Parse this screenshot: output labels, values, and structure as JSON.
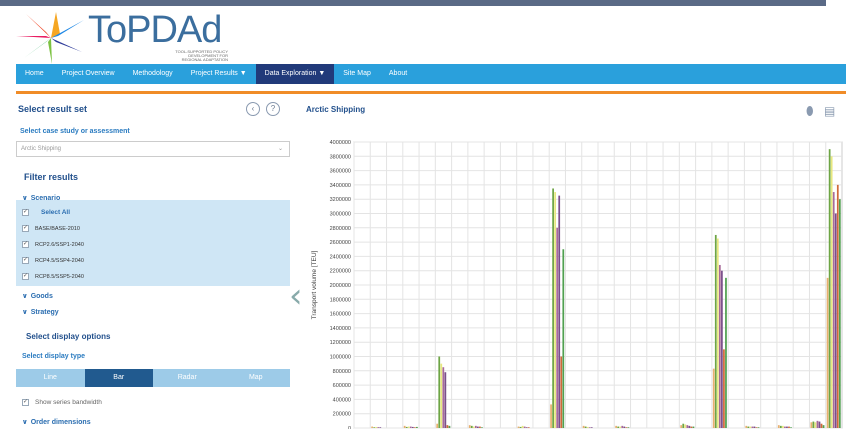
{
  "header": {
    "logo_text": "ToPDAd",
    "logo_sub": "TOOL-SUPPORTED POLICY DEVELOPMENT FOR REGIONAL ADAPTATION"
  },
  "nav": {
    "items": [
      {
        "label": "Home",
        "active": false
      },
      {
        "label": "Project Overview",
        "active": false
      },
      {
        "label": "Methodology",
        "active": false
      },
      {
        "label": "Project Results ▼",
        "active": false
      },
      {
        "label": "Data Exploration ▼",
        "active": true
      },
      {
        "label": "Site Map",
        "active": false
      },
      {
        "label": "About",
        "active": false
      }
    ]
  },
  "left": {
    "select_result_set": "Select result set",
    "back_icon": "‹",
    "help_icon": "?",
    "case_study_label": "Select case study or assessment",
    "case_study_value": "Arctic Shipping",
    "filter_results": "Filter results",
    "scenario": "Scenario",
    "select_all": "Select All",
    "scenarios": [
      "BASE/BASE-2010",
      "RCP2.6/SSP1-2040",
      "RCP4.5/SSP4-2040",
      "RCP8.5/SSP5-2040"
    ],
    "goods": "Goods",
    "strategy": "Strategy",
    "display_options": "Select display options",
    "display_type_label": "Select display type",
    "display_types": [
      {
        "label": "Line",
        "active": false
      },
      {
        "label": "Bar",
        "active": true
      },
      {
        "label": "Radar",
        "active": false
      },
      {
        "label": "Map",
        "active": false
      }
    ],
    "show_bandwidth": "Show series bandwidth",
    "order_dimensions": "Order dimensions"
  },
  "chart_title": "Arctic Shipping",
  "chart_data": {
    "type": "bar",
    "ylabel": "Transport volume [TEU]",
    "ylim": [
      0,
      4000000
    ],
    "ytick_labels": [
      "0",
      "200000",
      "400000",
      "600000",
      "800000",
      "1000000",
      "1200000",
      "1400000",
      "1600000",
      "1800000",
      "2000000",
      "2200000",
      "2400000",
      "2600000",
      "2800000",
      "3000000",
      "3200000",
      "3400000",
      "3600000",
      "3800000",
      "4000000"
    ],
    "series_colors": [
      "#e8b070",
      "#6da545",
      "#e8e880",
      "#a86a9a",
      "#7a4f8a",
      "#d06a3a",
      "#50a050"
    ],
    "groups": [
      {
        "values": [
          0,
          0,
          0,
          0,
          0,
          0,
          0
        ]
      },
      {
        "values": [
          20000,
          10000,
          15000,
          12000,
          10000,
          0,
          0
        ]
      },
      {
        "values": [
          0,
          0,
          0,
          0,
          0,
          0,
          0
        ]
      },
      {
        "values": [
          30000,
          15000,
          20000,
          20000,
          15000,
          10000,
          15000
        ]
      },
      {
        "values": [
          0,
          0,
          0,
          0,
          0,
          0,
          0
        ]
      },
      {
        "values": [
          60000,
          1000000,
          900000,
          850000,
          780000,
          40000,
          30000
        ]
      },
      {
        "values": [
          0,
          0,
          0,
          0,
          0,
          0,
          0
        ]
      },
      {
        "values": [
          40000,
          30000,
          20000,
          30000,
          20000,
          20000,
          10000
        ]
      },
      {
        "values": [
          0,
          0,
          0,
          0,
          0,
          0,
          0
        ]
      },
      {
        "values": [
          0,
          0,
          0,
          0,
          0,
          0,
          0
        ]
      },
      {
        "values": [
          20000,
          15000,
          30000,
          20000,
          10000,
          10000,
          0
        ]
      },
      {
        "values": [
          0,
          0,
          0,
          0,
          0,
          0,
          0
        ]
      },
      {
        "values": [
          330000,
          3350000,
          3300000,
          2800000,
          3250000,
          1000000,
          2500000
        ]
      },
      {
        "values": [
          0,
          0,
          0,
          0,
          0,
          0,
          0
        ]
      },
      {
        "values": [
          30000,
          20000,
          15000,
          10000,
          10000,
          0,
          0
        ]
      },
      {
        "values": [
          0,
          0,
          0,
          0,
          0,
          0,
          0
        ]
      },
      {
        "values": [
          30000,
          20000,
          20000,
          30000,
          20000,
          10000,
          10000
        ]
      },
      {
        "values": [
          0,
          0,
          0,
          0,
          0,
          0,
          0
        ]
      },
      {
        "values": [
          0,
          0,
          0,
          0,
          0,
          0,
          0
        ]
      },
      {
        "values": [
          0,
          0,
          0,
          0,
          0,
          0,
          0
        ]
      },
      {
        "values": [
          40000,
          60000,
          50000,
          40000,
          30000,
          20000,
          20000
        ]
      },
      {
        "values": [
          0,
          0,
          0,
          0,
          0,
          0,
          0
        ]
      },
      {
        "values": [
          830000,
          2700000,
          2650000,
          2280000,
          2200000,
          1100000,
          2100000
        ]
      },
      {
        "values": [
          0,
          0,
          0,
          0,
          0,
          0,
          0
        ]
      },
      {
        "values": [
          30000,
          20000,
          20000,
          20000,
          20000,
          10000,
          10000
        ]
      },
      {
        "values": [
          0,
          0,
          0,
          0,
          0,
          0,
          0
        ]
      },
      {
        "values": [
          40000,
          30000,
          30000,
          20000,
          20000,
          20000,
          10000
        ]
      },
      {
        "values": [
          0,
          0,
          0,
          0,
          0,
          0,
          0
        ]
      },
      {
        "values": [
          80000,
          90000,
          80000,
          100000,
          90000,
          60000,
          40000
        ]
      },
      {
        "values": [
          2100000,
          3900000,
          3800000,
          3300000,
          3000000,
          3400000,
          3200000
        ]
      }
    ]
  }
}
